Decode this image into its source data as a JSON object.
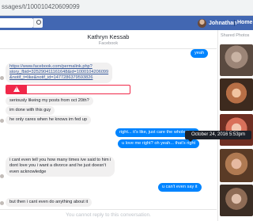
{
  "browser": {
    "url": "ssages/t/100010420609099"
  },
  "header": {
    "user_name": "Johnathan",
    "home_label": "Home"
  },
  "thread": {
    "name": "Kathryn Kessab",
    "status": "Facebook"
  },
  "sidebar": {
    "shared_title": "Shared Photos"
  },
  "tooltip": {
    "text": "October 24, 2016 5:53pm"
  },
  "messages": {
    "m0": "yeah",
    "link_lines": [
      "https://www.facebook.com/permalink.php?",
      "story_fbid=325290411161648&id=1000104206099",
      "&notif_t=like&notif_id=1477286379593826"
    ],
    "m2": "seriously likeing my posts from oct 20th?",
    "m3": "im done with this guy",
    "m4": "he only cares when he knows im fed up",
    "m5": "right... it's like, just care the whole time",
    "m6": "u love me right? oh yeah... that's right",
    "m7_lines": [
      "i cant even tell you how many times ive said to him i",
      "dont love you i want a divorce and he just doesn't",
      "even acknowledge"
    ],
    "m8": "u can't even say it",
    "m9": "but then i cant even do anything about it"
  },
  "reply_bar": {
    "text": "You cannot reply to this conversation."
  }
}
